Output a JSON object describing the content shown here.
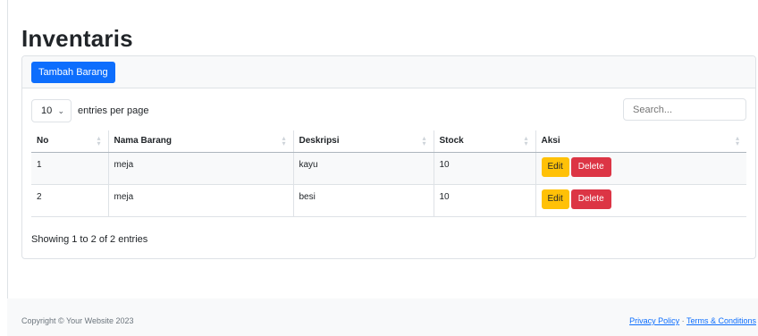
{
  "page": {
    "title": "Inventaris"
  },
  "toolbar": {
    "add_label": "Tambah Barang"
  },
  "table_controls": {
    "length_value": "10",
    "length_label": "entries per page",
    "search_placeholder": "Search..."
  },
  "table": {
    "columns": [
      "No",
      "Nama Barang",
      "Deskripsi",
      "Stock",
      "Aksi"
    ],
    "rows": [
      {
        "no": "1",
        "nama": "meja",
        "deskripsi": "kayu",
        "stock": "10",
        "edit": "Edit",
        "delete": "Delete"
      },
      {
        "no": "2",
        "nama": "meja",
        "deskripsi": "besi",
        "stock": "10",
        "edit": "Edit",
        "delete": "Delete"
      }
    ],
    "info": "Showing 1 to 2 of 2 entries"
  },
  "footer": {
    "copyright": "Copyright © Your Website 2023",
    "privacy": "Privacy Policy",
    "separator": "·",
    "terms": "Terms & Conditions"
  },
  "colors": {
    "primary": "#0d6efd",
    "warning": "#ffc107",
    "danger": "#dc3545"
  },
  "icons": {
    "length_chevron": "chevron-down-icon",
    "sort": "sort-icon"
  }
}
